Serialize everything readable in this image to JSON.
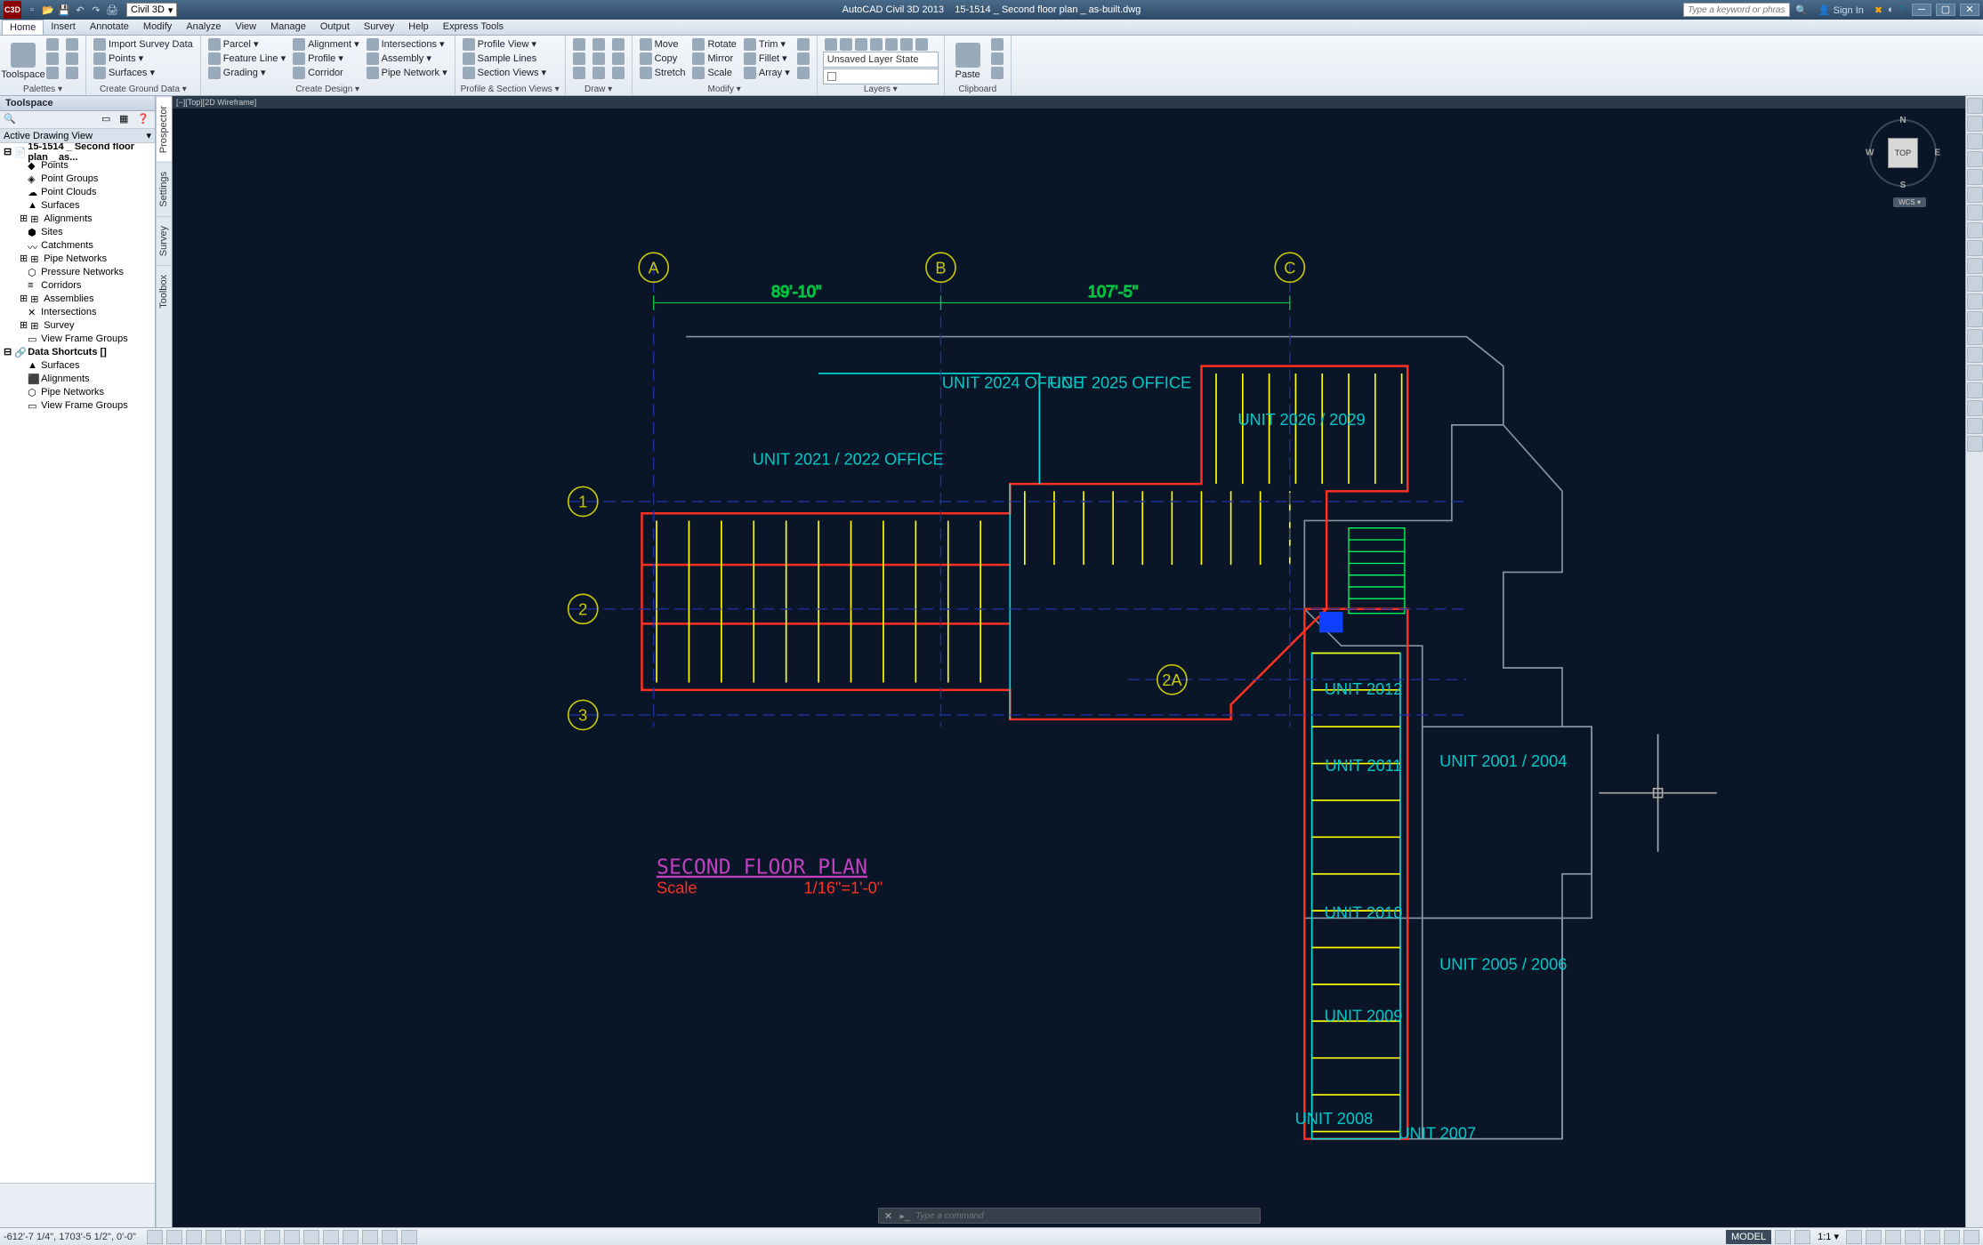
{
  "app_name": "AutoCAD Civil 3D 2013",
  "doc_name": "15-1514 _ Second floor plan _ as-built.dwg",
  "app_logo_text": "C3D",
  "workspace": "Civil 3D",
  "search_placeholder": "Type a keyword or phrase",
  "signin": "Sign In",
  "menus": [
    "Home",
    "Insert",
    "Annotate",
    "Modify",
    "Analyze",
    "View",
    "Manage",
    "Output",
    "Survey",
    "Help",
    "Express Tools"
  ],
  "active_menu": "Home",
  "ribbon_panels": {
    "palettes": {
      "title": "Palettes ▾",
      "big": "Toolspace"
    },
    "ground": {
      "title": "Create Ground Data ▾",
      "items": [
        "Import Survey Data",
        "Points ▾",
        "Surfaces ▾"
      ]
    },
    "design": {
      "title": "Create Design ▾",
      "col1": [
        "Parcel ▾",
        "Feature Line ▾",
        "Grading ▾"
      ],
      "col2": [
        "Alignment ▾",
        "Profile ▾",
        "Corridor"
      ],
      "col3": [
        "Intersections ▾",
        "Assembly ▾",
        "Pipe Network ▾"
      ]
    },
    "profile": {
      "title": "Profile & Section Views ▾",
      "items": [
        "Profile View ▾",
        "Sample Lines",
        "Section Views ▾"
      ]
    },
    "draw": {
      "title": "Draw ▾"
    },
    "modify": {
      "title": "Modify ▾",
      "col1": [
        "Move",
        "Copy",
        "Stretch"
      ],
      "col2": [
        "Rotate",
        "Mirror",
        "Scale"
      ],
      "col3": [
        "Trim ▾",
        "Fillet ▾",
        "Array ▾"
      ]
    },
    "layers": {
      "title": "Layers ▾",
      "state": "Unsaved Layer State"
    },
    "clipboard": {
      "title": "Clipboard",
      "big": "Paste"
    }
  },
  "palette": {
    "title": "Toolspace",
    "view_label": "Active Drawing View",
    "side_tabs": [
      "Prospector",
      "Settings",
      "Survey",
      "Toolbox"
    ],
    "active_side_tab": "Prospector",
    "tree": [
      {
        "d": 0,
        "ico": "📄",
        "label": "15-1514 _ Second floor plan _ as..."
      },
      {
        "d": 1,
        "ico": "◆",
        "label": "Points"
      },
      {
        "d": 1,
        "ico": "◈",
        "label": "Point Groups"
      },
      {
        "d": 1,
        "ico": "☁",
        "label": "Point Clouds"
      },
      {
        "d": 1,
        "ico": "▲",
        "label": "Surfaces"
      },
      {
        "d": 1,
        "ico": "⊞",
        "label": "Alignments",
        "exp": true
      },
      {
        "d": 1,
        "ico": "⬢",
        "label": "Sites"
      },
      {
        "d": 1,
        "ico": "〰",
        "label": "Catchments"
      },
      {
        "d": 1,
        "ico": "⊞",
        "label": "Pipe Networks",
        "exp": true
      },
      {
        "d": 1,
        "ico": "⬡",
        "label": "Pressure Networks"
      },
      {
        "d": 1,
        "ico": "≡",
        "label": "Corridors"
      },
      {
        "d": 1,
        "ico": "⊞",
        "label": "Assemblies",
        "exp": true
      },
      {
        "d": 1,
        "ico": "✕",
        "label": "Intersections"
      },
      {
        "d": 1,
        "ico": "⊞",
        "label": "Survey",
        "exp": true
      },
      {
        "d": 1,
        "ico": "▭",
        "label": "View Frame Groups"
      },
      {
        "d": 0,
        "ico": "🔗",
        "label": "Data Shortcuts []"
      },
      {
        "d": 1,
        "ico": "▲",
        "label": "Surfaces"
      },
      {
        "d": 1,
        "ico": "⬛",
        "label": "Alignments"
      },
      {
        "d": 1,
        "ico": "⬡",
        "label": "Pipe Networks"
      },
      {
        "d": 1,
        "ico": "▭",
        "label": "View Frame Groups"
      }
    ]
  },
  "viewport_label": "[−][Top][2D Wireframe]",
  "viewcube": {
    "face": "TOP",
    "n": "N",
    "s": "S",
    "e": "E",
    "w": "W",
    "wcs": "WCS ▾"
  },
  "drawing": {
    "title": "SECOND FLOOR PLAN",
    "scale_label": "Scale",
    "scale_value": "1/16\"=1'-0\"",
    "grids": {
      "col_labels": [
        "A",
        "B",
        "C"
      ],
      "row_labels": [
        "1",
        "2",
        "3"
      ],
      "extra_row": "2A",
      "dim_ab": "89'-10\"",
      "dim_bc": "107'-5\""
    },
    "unit_labels": [
      "UNIT 2021 / 2022 OFFICE",
      "UNIT 2024 OFFICE",
      "UNIT 2025 OFFICE",
      "UNIT 2026 / 2029",
      "UNIT 2012",
      "UNIT 2011",
      "UNIT 2010",
      "UNIT 2009",
      "UNIT 2008",
      "UNIT 2007",
      "UNIT 2005 / 2006",
      "UNIT 2001 / 2004"
    ]
  },
  "command_placeholder": "Type a command",
  "status": {
    "coords": "-612'-7 1/4\", 1703'-5 1/2\", 0'-0\"",
    "model": "MODEL",
    "scale": "1:1 ▾"
  }
}
